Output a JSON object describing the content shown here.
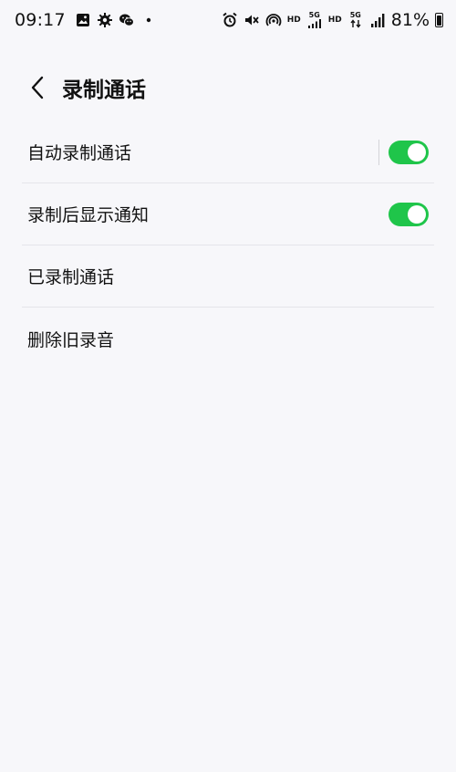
{
  "status_bar": {
    "time": "09:17",
    "hd_1": "HD",
    "net_1": "5G",
    "hd_2": "HD",
    "net_2": "5G",
    "battery": "81%"
  },
  "header": {
    "back_icon": "chevron-left-icon",
    "title": "录制通话"
  },
  "settings": {
    "items": [
      {
        "label": "自动录制通话",
        "toggle": true,
        "toggle_on": true
      },
      {
        "label": "录制后显示通知",
        "toggle": true,
        "toggle_on": true
      },
      {
        "label": "已录制通话",
        "toggle": false
      },
      {
        "label": "删除旧录音",
        "toggle": false
      }
    ]
  },
  "colors": {
    "toggle_on": "#1fc54a",
    "background": "#f7f7fa",
    "divider": "#e5e5ea"
  }
}
